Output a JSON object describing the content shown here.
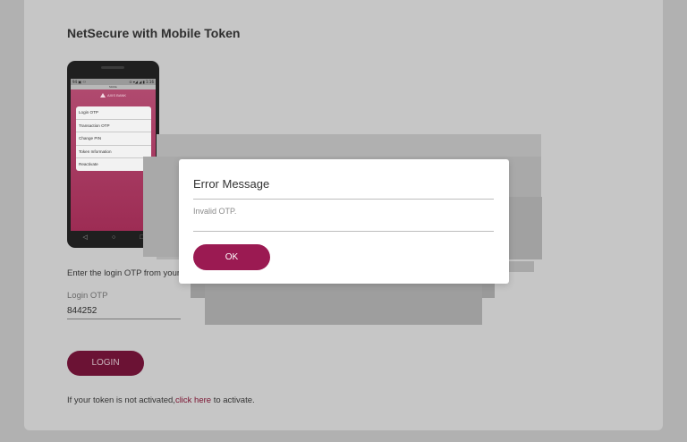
{
  "page": {
    "title": "NetSecure with Mobile Token"
  },
  "phone": {
    "status_left": "94 ▣ ⚇",
    "status_right": "⊙ ▾◢ ◢ ▮ 1:16",
    "app_title": "Mobile",
    "logo_text": "AXIS BANK",
    "menu_items": [
      {
        "label": "Login OTP"
      },
      {
        "label": "Transaction OTP"
      },
      {
        "label": "Change PIN"
      },
      {
        "label": "Token Information"
      },
      {
        "label": "Reactivate"
      }
    ],
    "nav": {
      "back": "◁",
      "home": "○",
      "recent": "□"
    }
  },
  "form": {
    "instruction": "Enter the login OTP from your",
    "otp_label": "Login OTP",
    "otp_value": "844252",
    "login_label": "LOGIN"
  },
  "footer": {
    "prefix": "If your token is not activated,",
    "link": "click here",
    "suffix": " to activate."
  },
  "dialog": {
    "title": "Error Message",
    "message": "Invalid OTP.",
    "ok_label": "OK"
  },
  "colors": {
    "brand": "#9b1a52",
    "login_button": "#6b1234",
    "link": "#7a1230"
  }
}
